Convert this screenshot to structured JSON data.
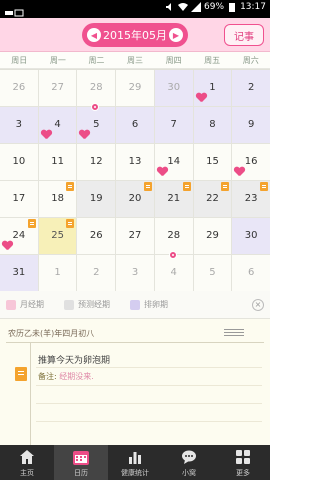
{
  "status_bar": {
    "battery": "69%",
    "time": "13:17"
  },
  "header": {
    "month_title": "2015年05月",
    "record_button": "记事"
  },
  "weekdays": [
    "周日",
    "周一",
    "周二",
    "周三",
    "周四",
    "周五",
    "周六"
  ],
  "calendar": {
    "weeks": [
      [
        {
          "d": "26",
          "dim": true,
          "bg": "normal"
        },
        {
          "d": "27",
          "dim": true,
          "bg": "normal"
        },
        {
          "d": "28",
          "dim": true,
          "bg": "normal"
        },
        {
          "d": "29",
          "dim": true,
          "bg": "normal"
        },
        {
          "d": "30",
          "dim": true,
          "bg": "ovul"
        },
        {
          "d": "1",
          "bg": "ovul",
          "heart": true
        },
        {
          "d": "2",
          "bg": "ovul"
        }
      ],
      [
        {
          "d": "3",
          "bg": "ovul"
        },
        {
          "d": "4",
          "bg": "ovul",
          "heart": true
        },
        {
          "d": "5",
          "bg": "ovul",
          "heart": true,
          "dot": true
        },
        {
          "d": "6",
          "bg": "ovul"
        },
        {
          "d": "7",
          "bg": "ovul"
        },
        {
          "d": "8",
          "bg": "ovul"
        },
        {
          "d": "9",
          "bg": "ovul"
        }
      ],
      [
        {
          "d": "10",
          "bg": "normal"
        },
        {
          "d": "11",
          "bg": "normal"
        },
        {
          "d": "12",
          "bg": "normal"
        },
        {
          "d": "13",
          "bg": "normal"
        },
        {
          "d": "14",
          "bg": "normal",
          "heart": true
        },
        {
          "d": "15",
          "bg": "normal"
        },
        {
          "d": "16",
          "bg": "normal",
          "heart": true
        }
      ],
      [
        {
          "d": "17",
          "bg": "normal"
        },
        {
          "d": "18",
          "bg": "normal",
          "note": true
        },
        {
          "d": "19",
          "bg": "forecast"
        },
        {
          "d": "20",
          "bg": "forecast",
          "note": true
        },
        {
          "d": "21",
          "bg": "forecast",
          "note": true
        },
        {
          "d": "22",
          "bg": "forecast",
          "note": true
        },
        {
          "d": "23",
          "bg": "forecast",
          "note": true
        }
      ],
      [
        {
          "d": "24",
          "bg": "normal",
          "heart": true,
          "note": true
        },
        {
          "d": "25",
          "bg": "today",
          "note": true
        },
        {
          "d": "26",
          "bg": "normal"
        },
        {
          "d": "27",
          "bg": "normal"
        },
        {
          "d": "28",
          "bg": "normal"
        },
        {
          "d": "29",
          "bg": "normal"
        },
        {
          "d": "30",
          "bg": "ovul"
        }
      ],
      [
        {
          "d": "31",
          "bg": "ovul"
        },
        {
          "d": "1",
          "dim": true,
          "bg": "normal"
        },
        {
          "d": "2",
          "dim": true,
          "bg": "normal"
        },
        {
          "d": "3",
          "dim": true,
          "bg": "normal"
        },
        {
          "d": "4",
          "dim": true,
          "bg": "normal",
          "dot": true
        },
        {
          "d": "5",
          "dim": true,
          "bg": "normal"
        },
        {
          "d": "6",
          "dim": true,
          "bg": "normal"
        }
      ]
    ]
  },
  "legend": {
    "items": [
      {
        "label": "月经期",
        "color": "#f7c6d8"
      },
      {
        "label": "预测经期",
        "color": "#e0e0e0"
      },
      {
        "label": "排卵期",
        "color": "#d4cdf0"
      }
    ],
    "close": "×"
  },
  "detail": {
    "lunar_date": "农历乙未(羊)年四月初八",
    "prediction": "推算今天为卵泡期",
    "remark_label": "备注:",
    "remark_value": "经期没来."
  },
  "bottom_tabs": [
    {
      "label": "主页",
      "icon": "home-icon"
    },
    {
      "label": "日历",
      "icon": "calendar-icon",
      "active": true
    },
    {
      "label": "健康统计",
      "icon": "bar-chart-icon"
    },
    {
      "label": "小窝",
      "icon": "chat-bubble-icon"
    },
    {
      "label": "更多",
      "icon": "grid-icon"
    }
  ],
  "colors": {
    "accent": "#f0518f",
    "header_bg": "#ffd6e6",
    "ovulation_bg": "#e9e6f7",
    "forecast_bg": "#ececec",
    "today_bg": "#f7f0b8",
    "heart": "#ec4d87",
    "note_tag": "#f4a32e",
    "tabbar_bg": "#2b2b2b"
  }
}
